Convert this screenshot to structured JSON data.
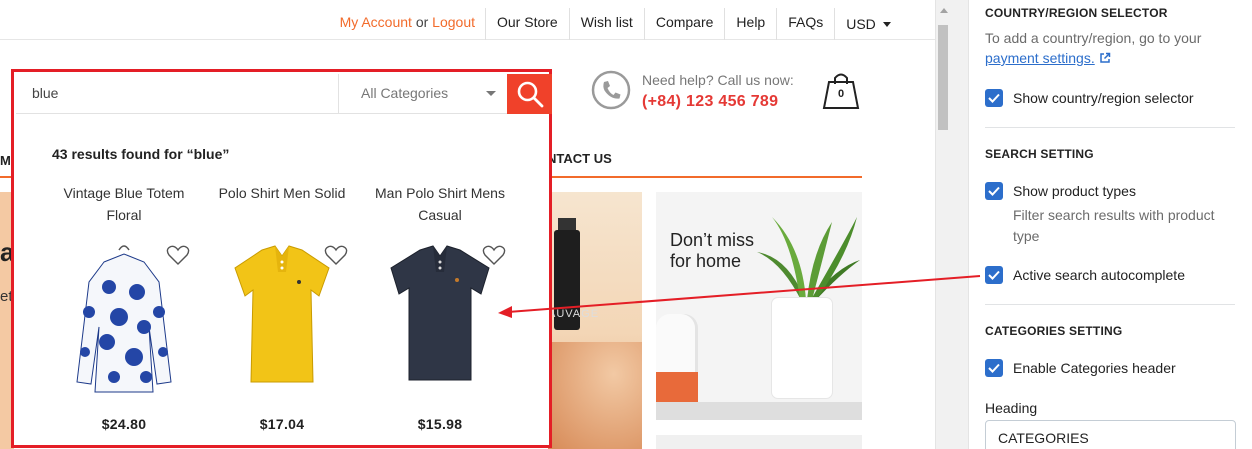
{
  "header": {
    "my_account": "My Account",
    "or": "or",
    "logout": "Logout",
    "links": [
      "Our Store",
      "Wish list",
      "Compare",
      "Help",
      "FAQs"
    ],
    "currency": "USD"
  },
  "help": {
    "question": "Need help? Call us now:",
    "phone": "(+84) 123 456 789"
  },
  "cart": {
    "count": "0"
  },
  "nav": {
    "left_fragment": "M",
    "contact": "NTACT US"
  },
  "hero": {
    "letter": "a",
    "text": "et"
  },
  "banners": {
    "perfume_text": "AUVAGE",
    "home_title": "Don’t miss\nfor home"
  },
  "search": {
    "value": "blue",
    "category": "All Categories",
    "results_heading": "43 results found for “blue”",
    "products": [
      {
        "name": "Vintage Blue Totem Floral",
        "price": "$24.80",
        "image": "blue-floral-shirt"
      },
      {
        "name": "Polo Shirt Men Solid",
        "price": "$17.04",
        "image": "yellow-polo"
      },
      {
        "name": "Man Polo Shirt Mens Casual",
        "price": "$15.98",
        "image": "navy-polo"
      }
    ]
  },
  "settings": {
    "country": {
      "title": "COUNTRY/REGION SELECTOR",
      "help_prefix": "To add a country/region, go to your",
      "help_link": "payment settings.",
      "checkbox": "Show country/region selector"
    },
    "search": {
      "title": "SEARCH SETTING",
      "show_types": "Show product types",
      "show_types_help": "Filter search results with product type",
      "autocomplete": "Active search autocomplete"
    },
    "categories": {
      "title": "CATEGORIES SETTING",
      "enable_header": "Enable Categories header",
      "heading_label": "Heading",
      "heading_value": "CATEGORIES"
    }
  },
  "colors": {
    "accent": "#f26b2b",
    "highlight": "#e41e26",
    "checkbox": "#2c6ecb"
  }
}
